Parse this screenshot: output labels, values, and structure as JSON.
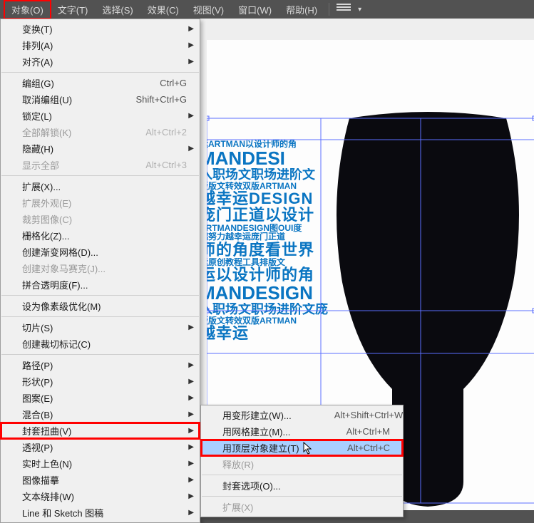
{
  "menubar": {
    "items": [
      "对象(O)",
      "文字(T)",
      "选择(S)",
      "效果(C)",
      "视图(V)",
      "窗口(W)",
      "帮助(H)"
    ],
    "active_index": 0
  },
  "main_menu": [
    {
      "label": "变换(T)",
      "submenu": true
    },
    {
      "label": "排列(A)",
      "submenu": true
    },
    {
      "label": "对齐(A)",
      "submenu": true
    },
    {
      "sep": true
    },
    {
      "label": "编组(G)",
      "shortcut": "Ctrl+G"
    },
    {
      "label": "取消编组(U)",
      "shortcut": "Shift+Ctrl+G"
    },
    {
      "label": "锁定(L)",
      "submenu": true
    },
    {
      "label": "全部解锁(K)",
      "shortcut": "Alt+Ctrl+2",
      "disabled": true
    },
    {
      "label": "隐藏(H)",
      "submenu": true
    },
    {
      "label": "显示全部",
      "shortcut": "Alt+Ctrl+3",
      "disabled": true
    },
    {
      "sep": true
    },
    {
      "label": "扩展(X)..."
    },
    {
      "label": "扩展外观(E)",
      "disabled": true
    },
    {
      "label": "裁剪图像(C)",
      "disabled": true
    },
    {
      "label": "栅格化(Z)..."
    },
    {
      "label": "创建渐变网格(D)..."
    },
    {
      "label": "创建对象马赛克(J)...",
      "disabled": true
    },
    {
      "label": "拼合透明度(F)..."
    },
    {
      "sep": true
    },
    {
      "label": "设为像素级优化(M)"
    },
    {
      "sep": true
    },
    {
      "label": "切片(S)",
      "submenu": true
    },
    {
      "label": "创建裁切标记(C)"
    },
    {
      "sep": true
    },
    {
      "label": "路径(P)",
      "submenu": true
    },
    {
      "label": "形状(P)",
      "submenu": true
    },
    {
      "label": "图案(E)",
      "submenu": true
    },
    {
      "label": "混合(B)",
      "submenu": true
    },
    {
      "label": "封套扭曲(V)",
      "submenu": true,
      "highlight": true
    },
    {
      "label": "透视(P)",
      "submenu": true
    },
    {
      "label": "实时上色(N)",
      "submenu": true
    },
    {
      "label": "图像描摹",
      "submenu": true
    },
    {
      "label": "文本绕排(W)",
      "submenu": true
    },
    {
      "label": "Line 和 Sketch 图稿",
      "submenu": true
    }
  ],
  "sub_menu": [
    {
      "label": "用变形建立(W)...",
      "shortcut": "Alt+Shift+Ctrl+W"
    },
    {
      "label": "用网格建立(M)...",
      "shortcut": "Alt+Ctrl+M"
    },
    {
      "label": "用顶层对象建立(T)",
      "shortcut": "Alt+Ctrl+C",
      "highlight": true
    },
    {
      "label": "释放(R)",
      "disabled": true
    },
    {
      "sep": true
    },
    {
      "label": "封套选项(O)..."
    },
    {
      "sep": true
    },
    {
      "label": "扩展(X)",
      "disabled": true
    }
  ],
  "design": {
    "rows": [
      "运ARTMAN以设计师的角",
      "MANDESI",
      "入职场文职场进阶文",
      "版版文转效双版ARTMAN",
      "越幸运DESIGN",
      "庞门正道以设计",
      "ARTMANDESIGN图OUI度",
      "越努力越幸运庞门正道",
      "师的角度看世界",
      "运原创教程工具排版文",
      "运以设计师的角",
      "MANDESIGN",
      "入职场文职场进阶文庞",
      "版版文转效双版ARTMAN",
      "越幸运"
    ]
  }
}
